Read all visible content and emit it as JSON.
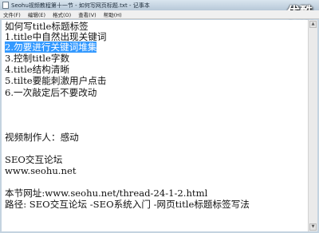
{
  "window": {
    "title": "Seohu视频教程第十一节 - 如何写网页标题.txt - 记事本",
    "watermark": "优酷"
  },
  "menu": [
    "文件(F)",
    "编辑(E)",
    "格式(O)",
    "查看(V)",
    "帮助(H)"
  ],
  "document": {
    "lines": [
      "如何写title标题标签",
      "1.title中自然出现关键词",
      "2.勿要进行关键词堆集",
      "3.控制title字数",
      "4.title结构清晰",
      "5.tilte要能刺激用户点击",
      "6.一次敲定后不要改动",
      "视频制作人：感动",
      "SEO交互论坛",
      "www.seohu.net",
      "本节网址:www.seohu.net/thread-24-1-2.html",
      "路径: SEO交互论坛 -SEO系统入门 -网页title标题标签写法"
    ],
    "selected_line_index": 2
  },
  "colors": {
    "selection": "#3399ff",
    "text": "#111111"
  }
}
